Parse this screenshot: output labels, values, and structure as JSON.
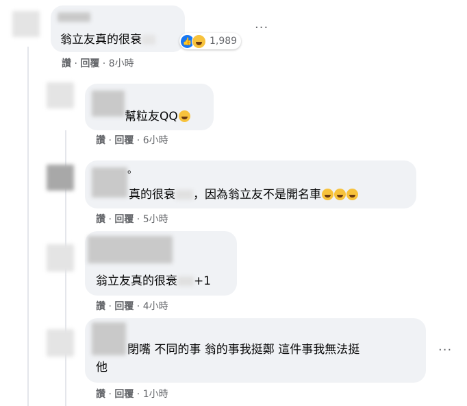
{
  "comments": [
    {
      "text": "翁立友真的很衰",
      "like": "讚",
      "reply": "回覆",
      "time": "8小時",
      "reaction_count": "1,989",
      "reactions": [
        "like-icon",
        "haha-icon"
      ]
    },
    {
      "text": "幫粒友QQ",
      "like": "讚",
      "reply": "回覆",
      "time": "6小時",
      "emoji": "sad-face-icon"
    },
    {
      "line1": "。",
      "text": "真的很衰",
      "text2": "，因為翁立友不是開名車",
      "like": "讚",
      "reply": "回覆",
      "time": "5小時",
      "emoji": [
        "rolling-laugh-icon",
        "rolling-laugh-icon",
        "rolling-laugh-icon"
      ]
    },
    {
      "text": "翁立友真的很衰",
      "text2": "+1",
      "like": "讚",
      "reply": "回覆",
      "time": "4小時"
    },
    {
      "line1": "閉嘴  不同的事  翁的事我挺鄭  這件事我無法挺",
      "line2": "他",
      "like": "讚",
      "reply": "回覆",
      "time": "1小時"
    }
  ],
  "separator": " · ",
  "more_glyph": "···"
}
